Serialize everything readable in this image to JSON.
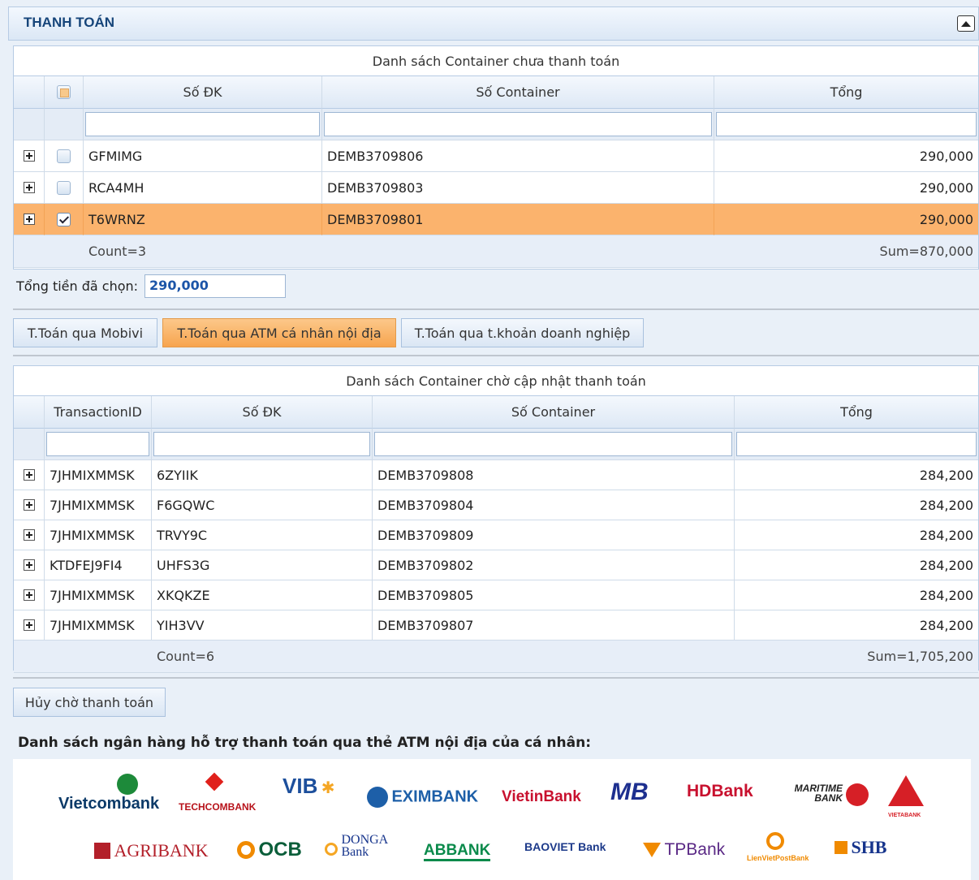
{
  "panel": {
    "title": "THANH TOÁN"
  },
  "unpaid": {
    "caption": "Danh sách Container chưa thanh toán",
    "headers": {
      "reg": "Số ĐK",
      "container": "Số Container",
      "total": "Tổng"
    },
    "rows": [
      {
        "reg": "GFMIMG",
        "container": "DEMB3709806",
        "total": "290,000",
        "checked": false
      },
      {
        "reg": "RCA4MH",
        "container": "DEMB3709803",
        "total": "290,000",
        "checked": false
      },
      {
        "reg": "T6WRNZ",
        "container": "DEMB3709801",
        "total": "290,000",
        "checked": true
      }
    ],
    "count": "Count=3",
    "sum": "Sum=870,000"
  },
  "selected_total": {
    "label": "Tổng tiền đã chọn:",
    "value": "290,000"
  },
  "payment_tabs": [
    {
      "label": "T.Toán qua Mobivi",
      "active": false
    },
    {
      "label": "T.Toán qua ATM cá nhân nội địa",
      "active": true
    },
    {
      "label": "T.Toán qua t.khoản doanh nghiệp",
      "active": false
    }
  ],
  "pending": {
    "caption": "Danh sách Container chờ cập nhật thanh toán",
    "headers": {
      "txid": "TransactionID",
      "reg": "Số ĐK",
      "container": "Số Container",
      "total": "Tổng"
    },
    "rows": [
      {
        "txid": "7JHMIXMMSK",
        "reg": "6ZYIIK",
        "container": "DEMB3709808",
        "total": "284,200"
      },
      {
        "txid": "7JHMIXMMSK",
        "reg": "F6GQWC",
        "container": "DEMB3709804",
        "total": "284,200"
      },
      {
        "txid": "7JHMIXMMSK",
        "reg": "TRVY9C",
        "container": "DEMB3709809",
        "total": "284,200"
      },
      {
        "txid": "KTDFEJ9FI4",
        "reg": "UHFS3G",
        "container": "DEMB3709802",
        "total": "284,200"
      },
      {
        "txid": "7JHMIXMMSK",
        "reg": "XKQKZE",
        "container": "DEMB3709805",
        "total": "284,200"
      },
      {
        "txid": "7JHMIXMMSK",
        "reg": "YIH3VV",
        "container": "DEMB3709807",
        "total": "284,200"
      }
    ],
    "count": "Count=6",
    "sum": "Sum=1,705,200"
  },
  "cancel_button": "Hủy chờ thanh toán",
  "banks": {
    "title": "Danh sách ngân hàng hỗ trợ thanh toán qua thẻ ATM nội địa của cá nhân:",
    "row1": [
      "Vietcombank",
      "TECHCOMBANK",
      "VIB",
      "EXIMBANK",
      "VietinBank",
      "MB",
      "HDBank",
      "MARITIME BANK",
      "VIETABANK"
    ],
    "row2": [
      "AGRIBANK",
      "OCB",
      "DONGA Bank",
      "ABBANK",
      "BAOVIET Bank",
      "TPBank",
      "LienVietPostBank",
      "SHB"
    ]
  }
}
